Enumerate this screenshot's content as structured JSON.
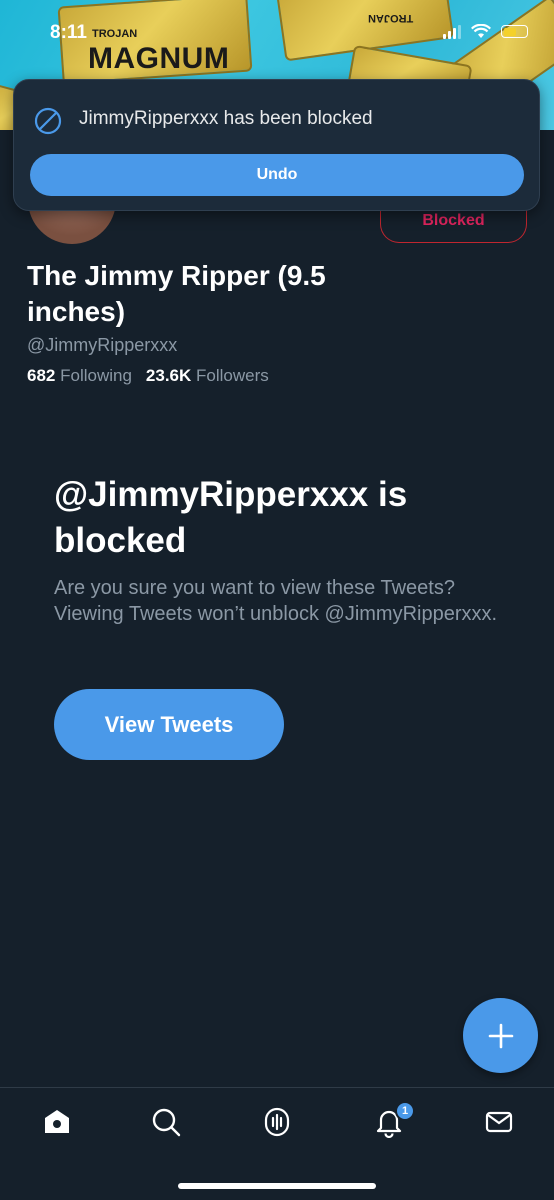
{
  "status_bar": {
    "time": "8:11"
  },
  "banner": {
    "brand_top": "TROJAN",
    "brand_main": "MAGNUM",
    "brand_flipped": "TROJAN"
  },
  "toast": {
    "message": "JimmyRipperxxx has been blocked",
    "undo_label": "Undo"
  },
  "profile": {
    "name": "The Jimmy Ripper (9.5 inches)",
    "handle": "@JimmyRipperxxx",
    "following_count": "682",
    "following_label": "Following",
    "followers_count": "23.6K",
    "followers_label": "Followers",
    "blocked_button_label": "Blocked"
  },
  "blocked_notice": {
    "title": "@JimmyRipperxxx is blocked",
    "description": "Are you sure you want to view these Tweets? Viewing Tweets won’t unblock @JimmyRipperxxx.",
    "button_label": "View Tweets"
  },
  "bottom_nav": {
    "items": [
      {
        "icon": "home-icon"
      },
      {
        "icon": "search-icon"
      },
      {
        "icon": "spaces-icon"
      },
      {
        "icon": "notifications-icon"
      },
      {
        "icon": "messages-icon"
      }
    ],
    "notification_badge": "1"
  },
  "colors": {
    "background": "#15202b",
    "accent": "#4a99e9",
    "blocked_red": "#e0245e",
    "secondary_text": "#8b98a5"
  }
}
